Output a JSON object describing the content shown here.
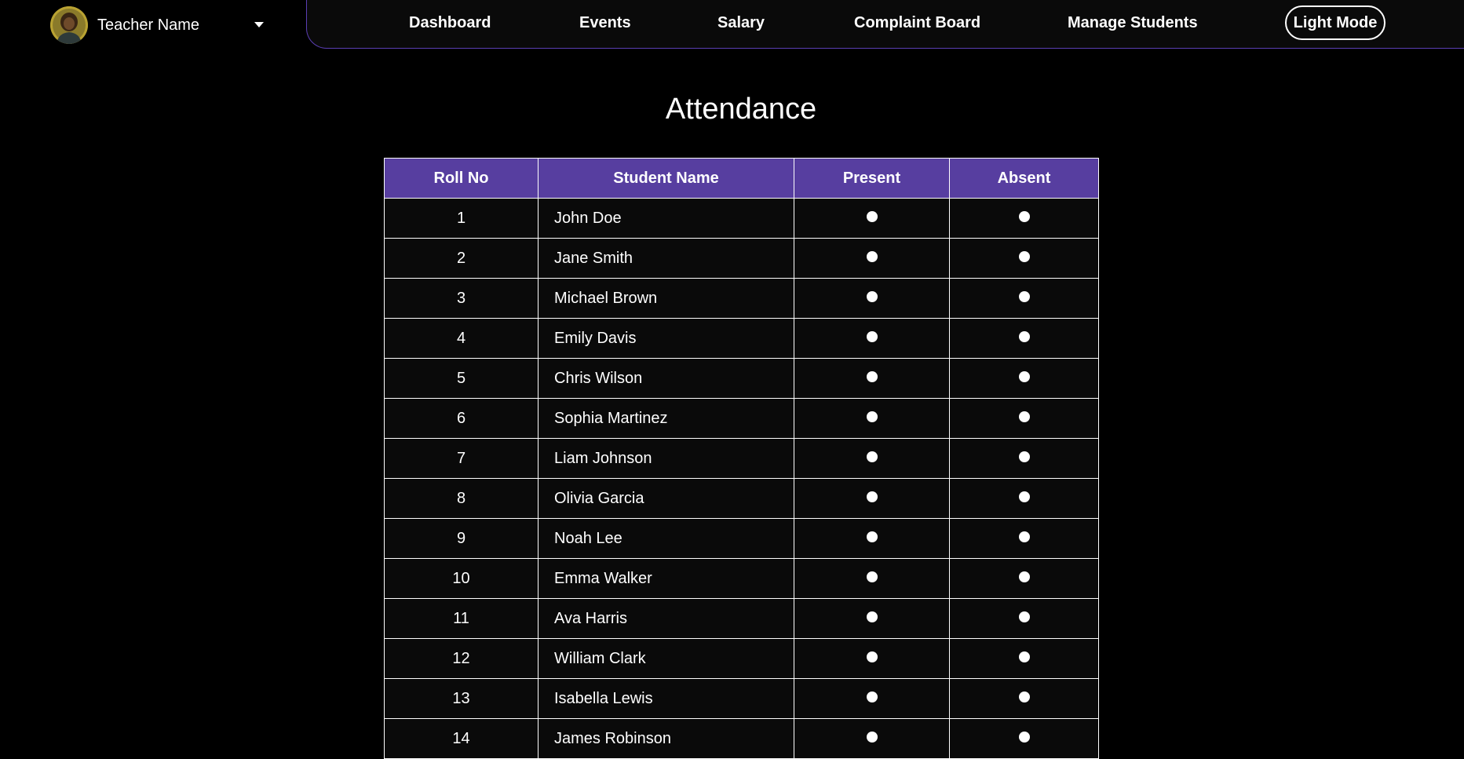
{
  "profile": {
    "name": "Teacher Name",
    "avatar_icon": "avatar-photo"
  },
  "nav": {
    "items": [
      {
        "label": "Dashboard"
      },
      {
        "label": "Events"
      },
      {
        "label": "Salary"
      },
      {
        "label": "Complaint Board"
      },
      {
        "label": "Manage Students"
      }
    ],
    "mode_toggle": "Light Mode"
  },
  "page": {
    "title": "Attendance"
  },
  "table": {
    "headers": [
      "Roll No",
      "Student Name",
      "Present",
      "Absent"
    ],
    "rows": [
      {
        "roll": "1",
        "name": "John Doe"
      },
      {
        "roll": "2",
        "name": "Jane Smith"
      },
      {
        "roll": "3",
        "name": "Michael Brown"
      },
      {
        "roll": "4",
        "name": "Emily Davis"
      },
      {
        "roll": "5",
        "name": "Chris Wilson"
      },
      {
        "roll": "6",
        "name": "Sophia Martinez"
      },
      {
        "roll": "7",
        "name": "Liam Johnson"
      },
      {
        "roll": "8",
        "name": "Olivia Garcia"
      },
      {
        "roll": "9",
        "name": "Noah Lee"
      },
      {
        "roll": "10",
        "name": "Emma Walker"
      },
      {
        "roll": "11",
        "name": "Ava Harris"
      },
      {
        "roll": "12",
        "name": "William Clark"
      },
      {
        "roll": "13",
        "name": "Isabella Lewis"
      },
      {
        "roll": "14",
        "name": "James Robinson"
      }
    ]
  },
  "colors": {
    "background": "#000000",
    "accent": "#573ea0",
    "nav_border": "#5b3fb4",
    "cell_bg": "#0a0a0a",
    "text": "#ffffff"
  }
}
